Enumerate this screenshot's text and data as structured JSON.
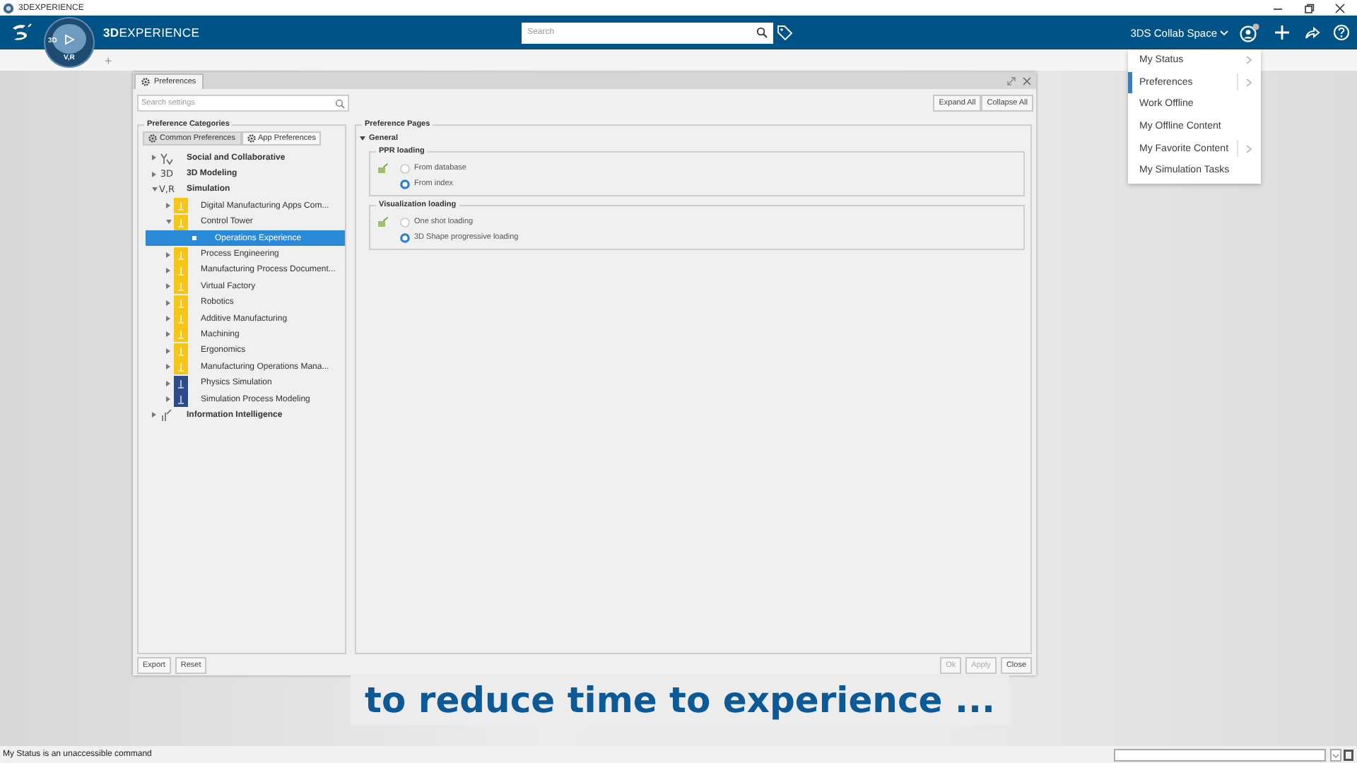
{
  "window": {
    "title": "3DEXPERIENCE"
  },
  "top_bar": {
    "brand_bold": "3D",
    "brand": "EXPERIENCE",
    "search": {
      "placeholder": "Search"
    },
    "collab_space": "3DS Collab Space"
  },
  "compass": {
    "left_label": "3D",
    "bottom_label": "V,R"
  },
  "tab_strip": {
    "add": "+"
  },
  "user_menu": {
    "items": [
      {
        "label": "My Status",
        "submenu": true,
        "selected": false
      },
      {
        "label": "Preferences",
        "submenu": true,
        "selected": true
      },
      {
        "label": "Work Offline",
        "submenu": false,
        "selected": false
      },
      {
        "label": "My Offline Content",
        "submenu": false,
        "selected": false
      },
      {
        "label": "My Favorite Content",
        "submenu": true,
        "selected": false
      },
      {
        "label": "My Simulation Tasks",
        "submenu": false,
        "selected": false
      }
    ]
  },
  "dialog": {
    "title": "Preferences",
    "search": {
      "placeholder": "Search settings"
    },
    "top_buttons": [
      "Expand All",
      "Collapse All"
    ],
    "categories": {
      "title": "Preference Categories",
      "tabs": [
        {
          "label": "Common Preferences",
          "selected": false
        },
        {
          "label": "App Preferences",
          "selected": true
        }
      ],
      "tree": [
        {
          "label": "Social and Collaborative",
          "kind": "social",
          "expanded": false,
          "selected": false
        },
        {
          "label": "3D Modeling",
          "kind": "text",
          "icon_text": "3D",
          "expanded": false,
          "selected": false
        },
        {
          "label": "Simulation",
          "kind": "text",
          "icon_text": "V,R",
          "expanded": true,
          "selected": false,
          "children": [
            {
              "label": "Digital Manufacturing Apps Com...",
              "color": "#f5c518",
              "expanded": false,
              "selected": false
            },
            {
              "label": "Control Tower",
              "color": "#f5c518",
              "expanded": true,
              "selected": false,
              "children": [
                {
                  "label": "Operations Experience",
                  "selected": true
                }
              ]
            },
            {
              "label": "Process Engineering",
              "color": "#f5c518",
              "expanded": false,
              "selected": false
            },
            {
              "label": "Manufacturing Process Document...",
              "color": "#f5c518",
              "expanded": false,
              "selected": false
            },
            {
              "label": "Virtual Factory",
              "color": "#f5c518",
              "expanded": false,
              "selected": false
            },
            {
              "label": "Robotics",
              "color": "#f5c518",
              "expanded": false,
              "selected": false
            },
            {
              "label": "Additive Manufacturing",
              "color": "#f5c518",
              "expanded": false,
              "selected": false
            },
            {
              "label": "Machining",
              "color": "#f5c518",
              "expanded": false,
              "selected": false
            },
            {
              "label": "Ergonomics",
              "color": "#f5c518",
              "expanded": false,
              "selected": false
            },
            {
              "label": "Manufacturing Operations Mana...",
              "color": "#f5c518",
              "expanded": false,
              "selected": false
            },
            {
              "label": "Physics Simulation",
              "color": "#2d4a8a",
              "expanded": false,
              "selected": false
            },
            {
              "label": "Simulation Process Modeling",
              "color": "#2d4a8a",
              "expanded": false,
              "selected": false
            }
          ]
        },
        {
          "label": "Information Intelligence",
          "kind": "info",
          "expanded": false,
          "selected": false
        }
      ]
    },
    "pages": {
      "title": "Preference Pages",
      "section": {
        "label": "General",
        "expanded": true
      },
      "groups": [
        {
          "title": "PPR loading",
          "options": [
            {
              "label": "From database",
              "selected": false
            },
            {
              "label": "From index",
              "selected": true
            }
          ]
        },
        {
          "title": "Visualization loading",
          "options": [
            {
              "label": "One shot loading",
              "selected": false
            },
            {
              "label": "3D Shape progressive loading",
              "selected": true
            }
          ]
        }
      ]
    },
    "footer_left": [
      {
        "label": "Export",
        "disabled": false
      },
      {
        "label": "Reset",
        "disabled": false
      }
    ],
    "footer_right": [
      {
        "label": "Ok",
        "disabled": true
      },
      {
        "label": "Apply",
        "disabled": true
      },
      {
        "label": "Close",
        "disabled": false
      }
    ]
  },
  "caption": "to reduce time to experience ...",
  "status_bar": {
    "message": "My Status is an unaccessible command"
  }
}
